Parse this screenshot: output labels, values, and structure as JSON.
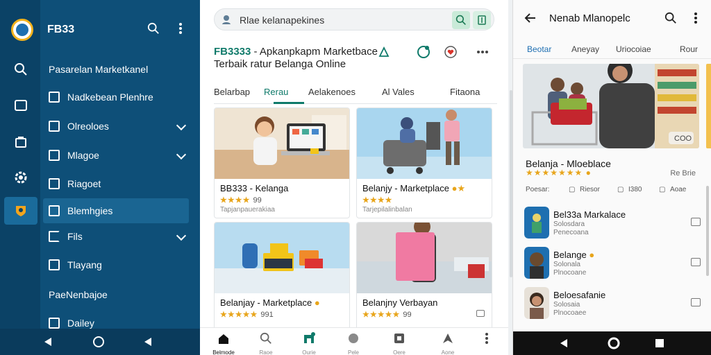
{
  "left_panel": {
    "title": "FB33",
    "section_heading": "Pasarelan Marketkanel",
    "items": [
      {
        "label": "Nadkebean Plenhre",
        "chevron": false
      },
      {
        "label": "Olreoloes",
        "chevron": true
      },
      {
        "label": "Mlagoe",
        "chevron": true
      },
      {
        "label": "Riagoet",
        "chevron": false
      },
      {
        "label": "Blemhgies",
        "chevron": false,
        "active": true
      },
      {
        "label": "Fils",
        "chevron": true
      },
      {
        "label": "Tlayang",
        "chevron": false
      }
    ],
    "section_heading_2": "PaeNenbajoe",
    "items_2": [
      {
        "label": "Dailey"
      }
    ]
  },
  "middle_panel": {
    "search_placeholder": "Rlae kelanapekines",
    "title_brand": "FB3333",
    "title_line1": " - Apkanpkapm Marketbace",
    "title_line2": "Terbaik ratur Belanga Online",
    "tabs": [
      {
        "label": "Belarbap",
        "active": false
      },
      {
        "label": "Rerau",
        "active": true
      },
      {
        "label": "Aelakenoes",
        "active": false
      },
      {
        "label": "Al Vales",
        "active": false
      },
      {
        "label": "Fitaona",
        "active": false
      }
    ],
    "cards": [
      {
        "title": "BB333 - Kelanga",
        "stars": "★★★★",
        "rating": "99",
        "sub": "Tapjanpauerakiaa"
      },
      {
        "title": "Belanjy - Marketplace",
        "stars": "★★★★",
        "rating": "",
        "sub": "Tarjepilalinbalan"
      },
      {
        "title": "Belanjay - Marketplace",
        "stars": "★★★★★",
        "rating": "991",
        "sub": ""
      },
      {
        "title": "Belanjny Verbayan",
        "stars": "★★★★★",
        "rating": "99",
        "sub": ""
      }
    ],
    "bottom_nav": [
      {
        "label": "Belmode",
        "icon": "home-icon"
      },
      {
        "label": "Raoe",
        "icon": "search-icon"
      },
      {
        "label": "Ourie",
        "icon": "store-icon"
      },
      {
        "label": "Pele",
        "icon": "circle-icon"
      },
      {
        "label": "Oere",
        "icon": "box-icon"
      },
      {
        "label": "Aone",
        "icon": "tag-icon"
      },
      {
        "label": "",
        "icon": "more-icon"
      }
    ]
  },
  "right_panel": {
    "title": "Nenab Mlanopelc",
    "tabs": [
      {
        "label": "Beotar",
        "active": true
      },
      {
        "label": "Aneyay",
        "active": false
      },
      {
        "label": "Uriocoiae",
        "active": false
      },
      {
        "label": "Rour",
        "active": false
      }
    ],
    "hero_badge": "COO",
    "hero_title": "Belanja - Mloeblace",
    "hero_stars": "★★★★★★★",
    "hero_price": "Re Brie",
    "meta_row": [
      {
        "label": "Poesar:"
      },
      {
        "label": "Riesor"
      },
      {
        "label": "I380"
      },
      {
        "label": "Aoae"
      }
    ],
    "list": [
      {
        "title": "Bel33a Markalace",
        "sub1": "Solosdara",
        "sub2": "Penecoana"
      },
      {
        "title": "Belange",
        "sub1": "Solonala",
        "sub2": "Plnocoane"
      },
      {
        "title": "Beloesafanie",
        "sub1": "Solosaia",
        "sub2": "Plnocoaee"
      }
    ]
  },
  "colors": {
    "left_bg": "#0e4f78",
    "accent_teal": "#0f7a6a",
    "star": "#e8a51b",
    "blue_tab": "#1f6fb2"
  }
}
